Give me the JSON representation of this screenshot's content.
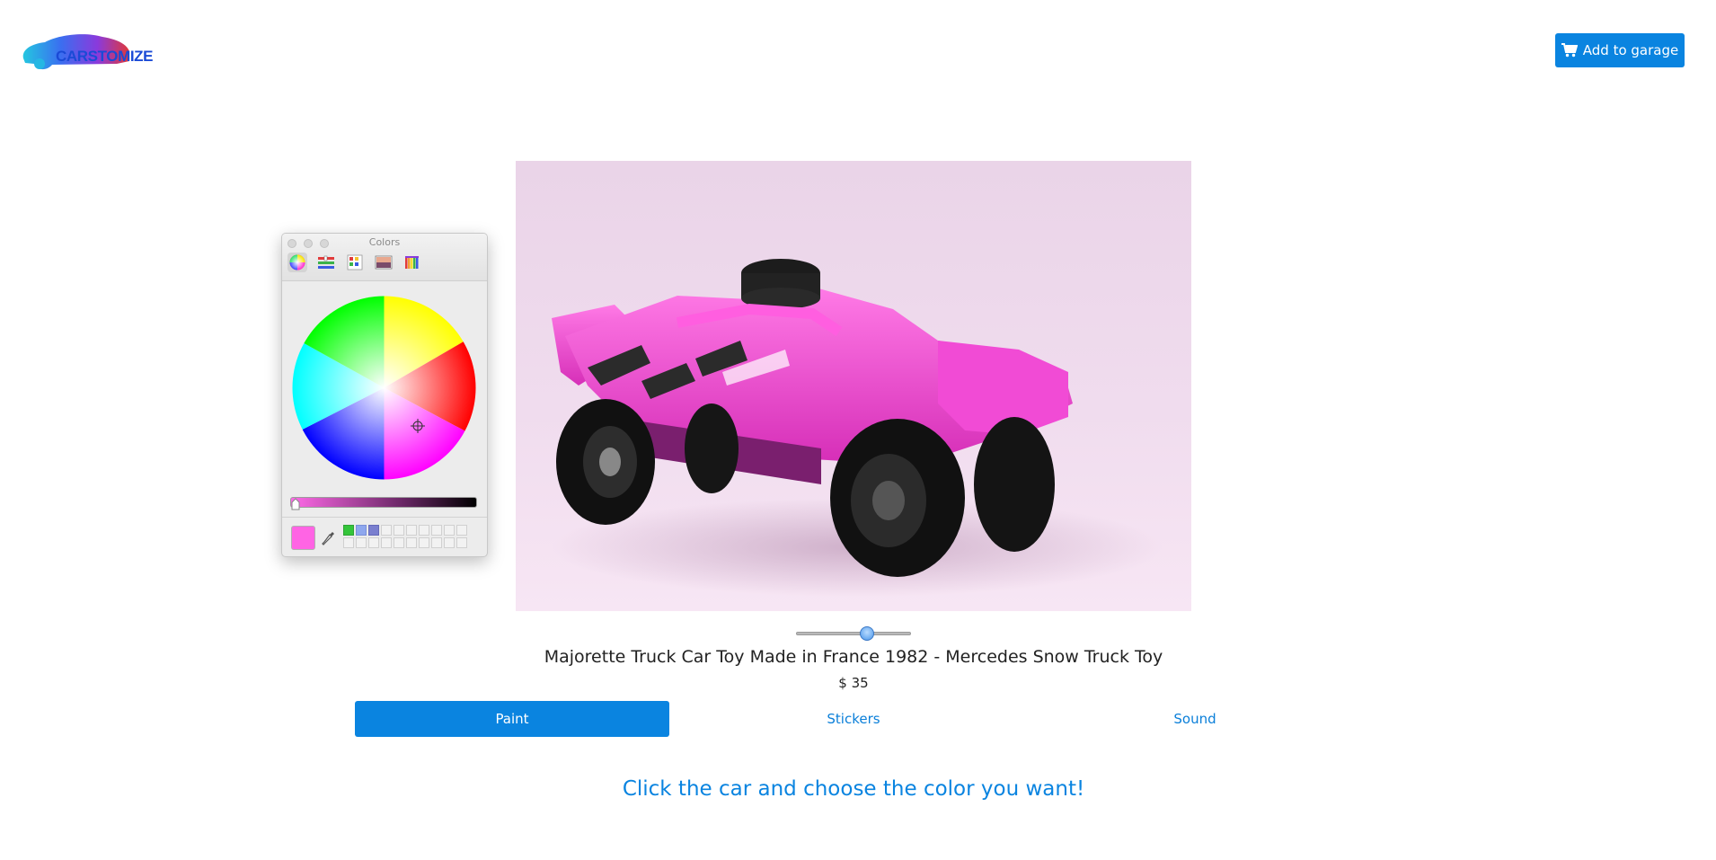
{
  "header": {
    "logo_text": "CARSTOMIZE",
    "garage_button_label": "Add to garage"
  },
  "product": {
    "title": "Majorette Truck Car Toy Made in France 1982 - Mercedes Snow Truck Toy",
    "price": "$ 35",
    "car_color": "#ff3fd8"
  },
  "slider": {
    "value": 0.6
  },
  "tabs": [
    {
      "label": "Paint",
      "active": true
    },
    {
      "label": "Stickers",
      "active": false
    },
    {
      "label": "Sound",
      "active": false
    }
  ],
  "instruction": "Click the car and choose the color you want!",
  "colors_panel": {
    "title": "Colors",
    "modes": [
      "color-wheel-icon",
      "sliders-icon",
      "palettes-icon",
      "image-palettes-icon",
      "crayons-icon"
    ],
    "current_color": "#ff64e4",
    "brightness": 1.0,
    "swatches": [
      "#34c53a",
      "#8ea7ee",
      "#7a7fcf"
    ]
  },
  "colors": {
    "accent": "#0a84e0",
    "logo_blue": "#1a4ad6"
  }
}
